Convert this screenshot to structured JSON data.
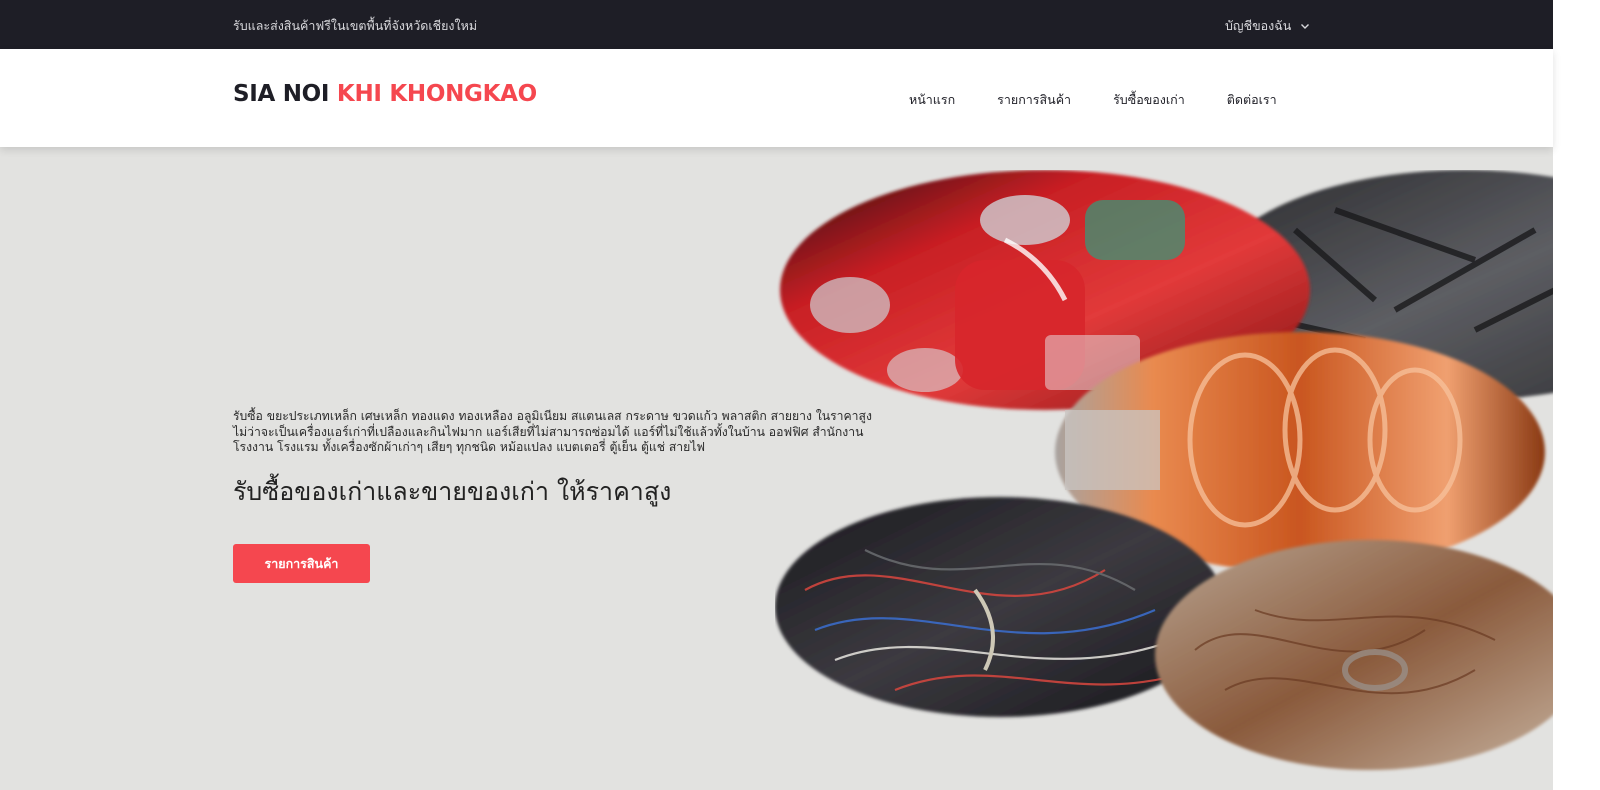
{
  "topbar": {
    "promo_text": "รับและส่งสินค้าฟรีในเขตพื้นที่จังหวัดเชียงใหม่",
    "account_label": "บัญชีของฉัน",
    "account_icon": "chevron-down-icon"
  },
  "header": {
    "logo_part1": "SIA NOI",
    "logo_part2": "KHI KHONGKAO",
    "nav": [
      {
        "label": "หน้าแรก"
      },
      {
        "label": "รายการสินค้า"
      },
      {
        "label": "รับซื้อของเก่า"
      },
      {
        "label": "ติดต่อเรา"
      }
    ]
  },
  "hero": {
    "description": "รับซื้อ ขยะประเภทเหล็ก เศษเหล็ก ทองแดง ทองเหลือง อลูมิเนียม สแตนเลส กระดาษ ขวดแก้ว พลาสติก สายยาง ในราคาสูง ไม่ว่าจะเป็นเครื่องแอร์เก่าที่เปลืองและกินไฟมาก แอร์เสียที่ไม่สามารถซ่อมได้ แอร์ที่ไม่ใช้แล้วทั้งในบ้าน ออฟฟิศ สำนักงาน โรงงาน โรงแรม ทั้งเครื่องซักผ้าเก่าๆ เสียๆ ทุกชนิด หม้อแปลง แบตเตอรี่ ตู้เย็น ตู้แช่ สายไฟ",
    "headline": "รับซื้อของเก่าและขายของเก่า ให้ราคาสูง",
    "cta_label": "รายการสินค้า"
  },
  "colors": {
    "accent": "#f5474f",
    "topbar_bg": "#1e1e26",
    "hero_bg": "#e2e2e0"
  }
}
